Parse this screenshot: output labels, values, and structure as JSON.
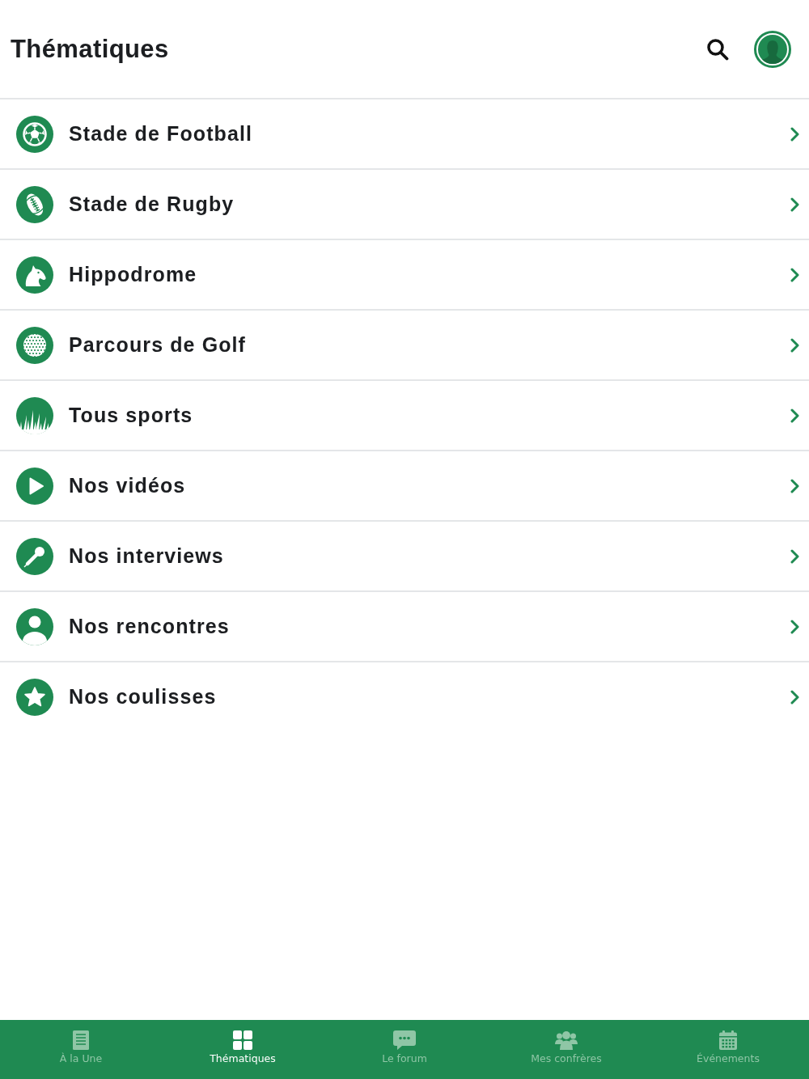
{
  "header": {
    "title": "Thématiques"
  },
  "categories": [
    {
      "label": "Stade de Football",
      "kind": "football"
    },
    {
      "label": "Stade de Rugby",
      "kind": "rugby"
    },
    {
      "label": "Hippodrome",
      "kind": "horse"
    },
    {
      "label": "Parcours de Golf",
      "kind": "golf"
    },
    {
      "label": "Tous sports",
      "kind": "grass"
    },
    {
      "label": "Nos vidéos",
      "kind": "play"
    },
    {
      "label": "Nos interviews",
      "kind": "microphone"
    },
    {
      "label": "Nos rencontres",
      "kind": "person"
    },
    {
      "label": "Nos coulisses",
      "kind": "star"
    }
  ],
  "tab_bar": [
    {
      "label": "À la Une",
      "kind": "news",
      "selected": false
    },
    {
      "label": "Thématiques",
      "kind": "grid",
      "selected": true
    },
    {
      "label": "Le forum",
      "kind": "chat",
      "selected": false
    },
    {
      "label": "Mes confrères",
      "kind": "group",
      "selected": false
    },
    {
      "label": "Événements",
      "kind": "calendar",
      "selected": false
    }
  ]
}
